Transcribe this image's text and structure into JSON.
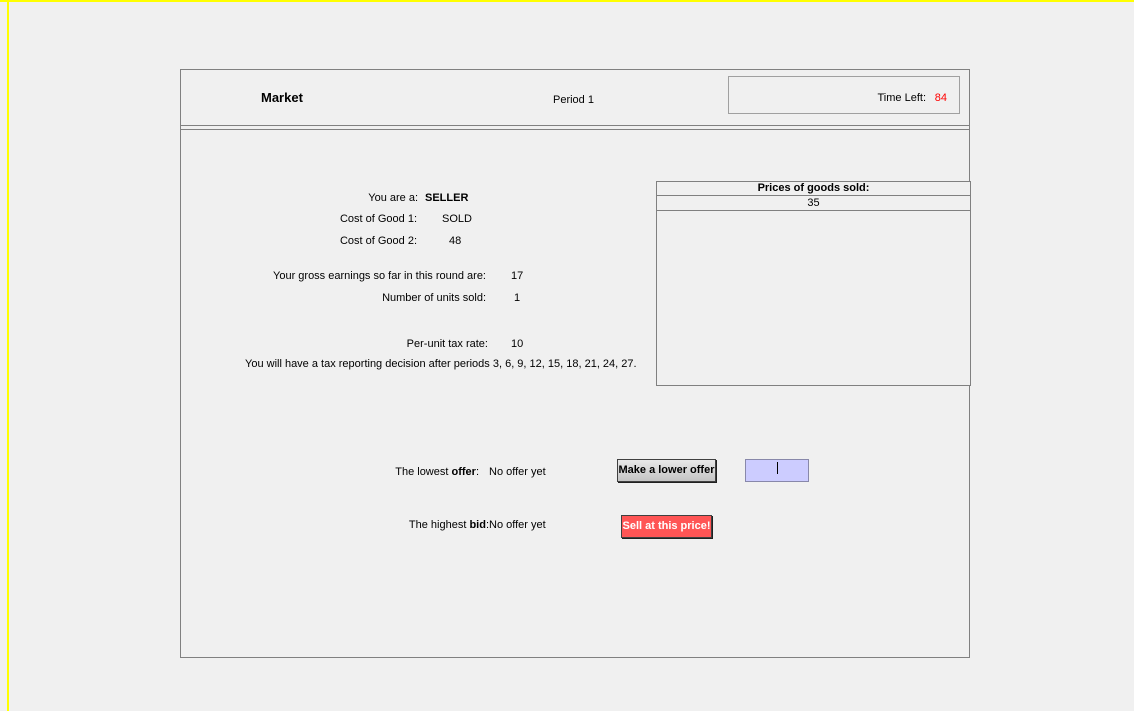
{
  "header": {
    "title": "Market",
    "period": "Period 1",
    "time_left_label": "Time Left:",
    "time_left_value": "84"
  },
  "info": {
    "role_label": "You are a:",
    "role_value": "SELLER",
    "good1_label": "Cost of Good 1:",
    "good1_value": "SOLD",
    "good2_label": "Cost of Good 2:",
    "good2_value": "48",
    "earnings_label": "Your gross earnings so far in this round are:",
    "earnings_value": "17",
    "units_label": "Number of units sold:",
    "units_value": "1",
    "tax_label": "Per-unit tax rate:",
    "tax_value": "10",
    "tax_note": "You will have a tax reporting decision after periods 3, 6, 9, 12, 15, 18, 21, 24, 27."
  },
  "prices": {
    "header": "Prices of goods sold:",
    "rows": [
      "35"
    ]
  },
  "market": {
    "lowest_prefix": "The lowest ",
    "lowest_keyword": "offer",
    "lowest_suffix": ":",
    "lowest_value": "No offer yet",
    "lower_offer_button": "Make a lower offer",
    "offer_input_value": "",
    "highest_prefix": "The highest ",
    "highest_keyword": "bid",
    "highest_suffix": ":",
    "highest_value": "No offer yet",
    "sell_button": "Sell at this price!"
  },
  "colors": {
    "frame": "#ffff00",
    "time_value": "#ff0000",
    "sell_button": "#ff5555",
    "input_bg": "#ccccff"
  }
}
